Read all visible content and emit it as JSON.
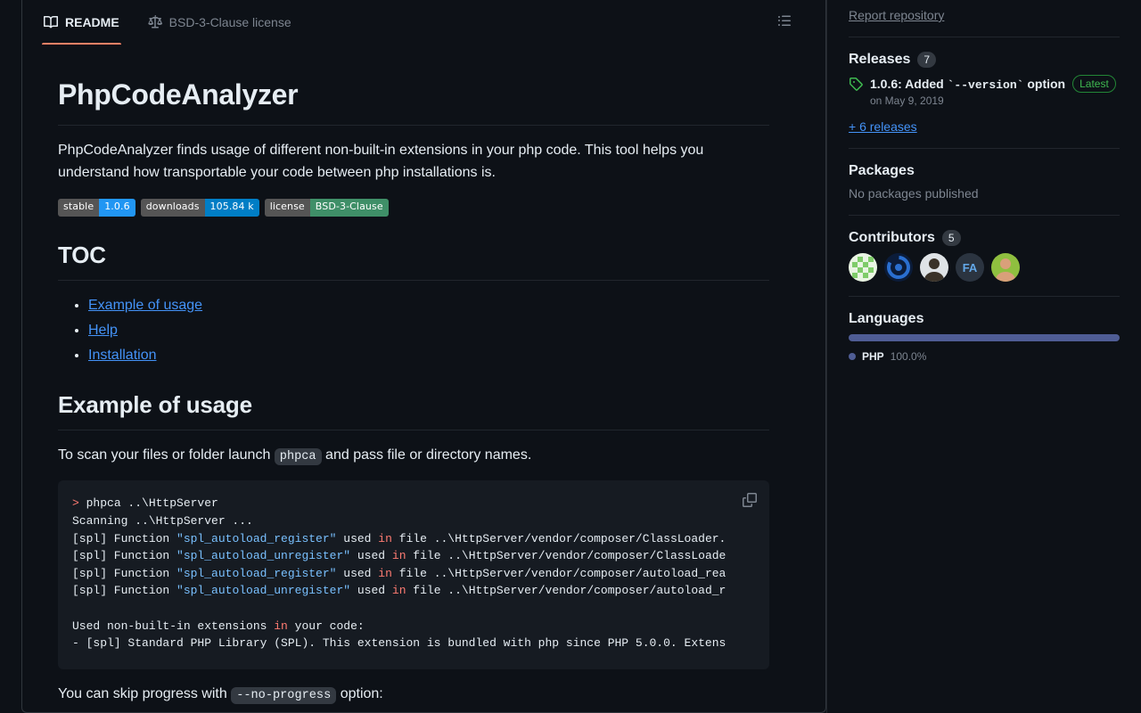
{
  "readme": {
    "tabs": [
      {
        "label": "README",
        "icon": "book-icon",
        "active": true
      },
      {
        "label": "BSD-3-Clause license",
        "icon": "law-icon",
        "active": false
      }
    ],
    "outline_icon": "list-unordered-icon",
    "title": "PhpCodeAnalyzer",
    "intro": "PhpCodeAnalyzer finds usage of different non-built-in extensions in your php code. This tool helps you understand how transportable your code between php installations is.",
    "badges": [
      {
        "label": "stable",
        "value": "1.0.6",
        "color": "#2196f3"
      },
      {
        "label": "downloads",
        "value": "105.84 k",
        "color": "#007ec6"
      },
      {
        "label": "license",
        "value": "BSD-3-Clause",
        "color": "#3f8f68"
      }
    ],
    "toc_heading": "TOC",
    "toc_items": [
      {
        "label": "Example of usage"
      },
      {
        "label": "Help"
      },
      {
        "label": "Installation"
      }
    ],
    "usage_heading": "Example of usage",
    "usage_paragraph": {
      "before": "To scan your files or folder launch",
      "code": "phpca",
      "after": "and pass file or directory names."
    },
    "code_block": {
      "copy_icon": "copy-icon",
      "lines": [
        [
          {
            "t": "> ",
            "c": "prompt"
          },
          {
            "t": "phpca ..\\HttpServer",
            "c": ""
          }
        ],
        [
          {
            "t": "Scanning ..\\HttpServer ...",
            "c": ""
          }
        ],
        [
          {
            "t": "[spl] Function ",
            "c": ""
          },
          {
            "t": "\"spl_autoload_register\"",
            "c": "str"
          },
          {
            "t": " used ",
            "c": ""
          },
          {
            "t": "in",
            "c": "kw"
          },
          {
            "t": " file ..\\HttpServer/vendor/composer/ClassLoader.",
            "c": ""
          }
        ],
        [
          {
            "t": "[spl] Function ",
            "c": ""
          },
          {
            "t": "\"spl_autoload_unregister\"",
            "c": "str"
          },
          {
            "t": " used ",
            "c": ""
          },
          {
            "t": "in",
            "c": "kw"
          },
          {
            "t": " file ..\\HttpServer/vendor/composer/ClassLoade",
            "c": ""
          }
        ],
        [
          {
            "t": "[spl] Function ",
            "c": ""
          },
          {
            "t": "\"spl_autoload_register\"",
            "c": "str"
          },
          {
            "t": " used ",
            "c": ""
          },
          {
            "t": "in",
            "c": "kw"
          },
          {
            "t": " file ..\\HttpServer/vendor/composer/autoload_rea",
            "c": ""
          }
        ],
        [
          {
            "t": "[spl] Function ",
            "c": ""
          },
          {
            "t": "\"spl_autoload_unregister\"",
            "c": "str"
          },
          {
            "t": " used ",
            "c": ""
          },
          {
            "t": "in",
            "c": "kw"
          },
          {
            "t": " file ..\\HttpServer/vendor/composer/autoload_r",
            "c": ""
          }
        ],
        [
          {
            "t": "",
            "c": ""
          }
        ],
        [
          {
            "t": "Used non-built-in extensions ",
            "c": ""
          },
          {
            "t": "in",
            "c": "kw"
          },
          {
            "t": " your code:",
            "c": ""
          }
        ],
        [
          {
            "t": "- [spl] Standard PHP Library (SPL). This extension is bundled with php since PHP 5.0.0. Extens",
            "c": ""
          }
        ]
      ]
    },
    "skip_paragraph": {
      "before": "You can skip progress with",
      "code": "--no-progress",
      "after": "option:"
    }
  },
  "sidebar": {
    "report_link": "Report repository",
    "releases": {
      "title": "Releases",
      "count": "7",
      "tag_icon": "tag-icon",
      "latest_name_prefix": "1.0.6: Added ",
      "latest_name_code": "`--version`",
      "latest_name_suffix": " option",
      "latest_badge": "Latest",
      "date": "on May 9, 2019",
      "more": "+ 6 releases"
    },
    "packages": {
      "title": "Packages",
      "empty": "No packages published"
    },
    "contributors": {
      "title": "Contributors",
      "count": "5",
      "avatars": [
        {
          "name": "contributor-avatar-1",
          "bg": "#e9f5e3",
          "fg": "#7fcc6a"
        },
        {
          "name": "contributor-avatar-2",
          "bg": "#0b1c3a",
          "fg": "#2a6fd0"
        },
        {
          "name": "contributor-avatar-3",
          "bg": "#dfe3e6",
          "fg": "#3a3228"
        },
        {
          "name": "contributor-avatar-4",
          "bg": "#2b3440",
          "fg": "#63a8e8"
        },
        {
          "name": "contributor-avatar-5",
          "bg": "#8fbf3f",
          "fg": "#d9a07a"
        }
      ]
    },
    "languages": {
      "title": "Languages",
      "items": [
        {
          "name": "PHP",
          "percent": "100.0%",
          "color": "#4F5D95",
          "width": "100%"
        }
      ]
    }
  }
}
